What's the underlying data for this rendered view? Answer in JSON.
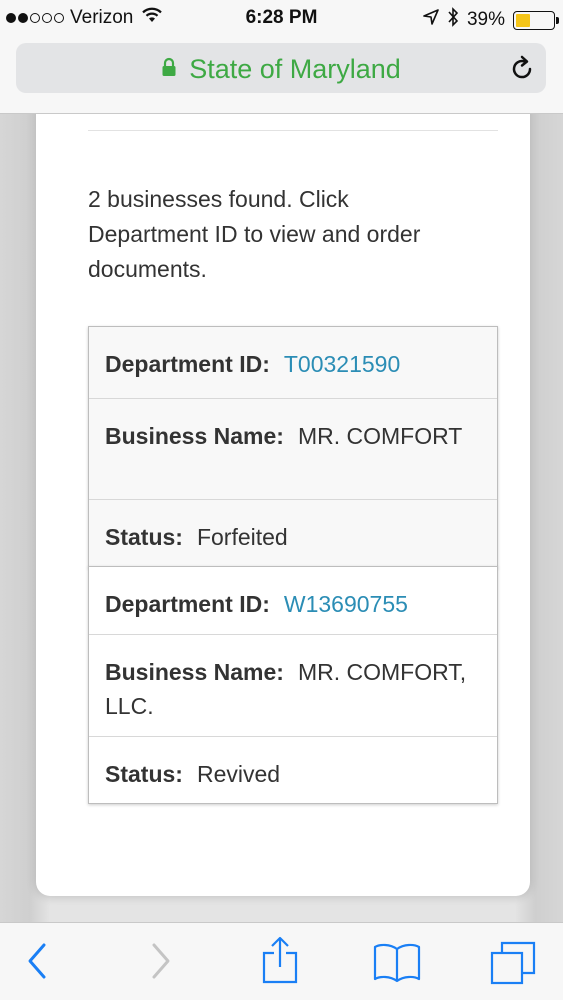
{
  "status_bar": {
    "carrier": "Verizon",
    "time": "6:28 PM",
    "battery_percent": "39%",
    "battery_level": 0.39,
    "icons": [
      "signal-dots-icon",
      "wifi-icon",
      "location-arrow-icon",
      "bluetooth-icon",
      "battery-icon"
    ]
  },
  "address_bar": {
    "title": "State of Maryland",
    "secure_color": "#3ea944",
    "icons": [
      "lock-icon",
      "reload-icon"
    ]
  },
  "page": {
    "intro": "2 businesses found. Click Department ID to view and order documents.",
    "results": [
      {
        "department_id_label": "Department ID:",
        "department_id": "T00321590",
        "business_name_label": "Business Name:",
        "business_name": "MR. COMFORT",
        "status_label": "Status:",
        "status": "Forfeited"
      },
      {
        "department_id_label": "Department ID:",
        "department_id": "W13690755",
        "business_name_label": "Business Name:",
        "business_name": "MR. COMFORT, LLC.",
        "status_label": "Status:",
        "status": "Revived"
      }
    ],
    "link_color": "#2b8db5"
  },
  "toolbar": {
    "icons": [
      "back-icon",
      "forward-icon",
      "share-icon",
      "bookmarks-icon",
      "tabs-icon"
    ],
    "accent_color": "#1a7ff5"
  }
}
